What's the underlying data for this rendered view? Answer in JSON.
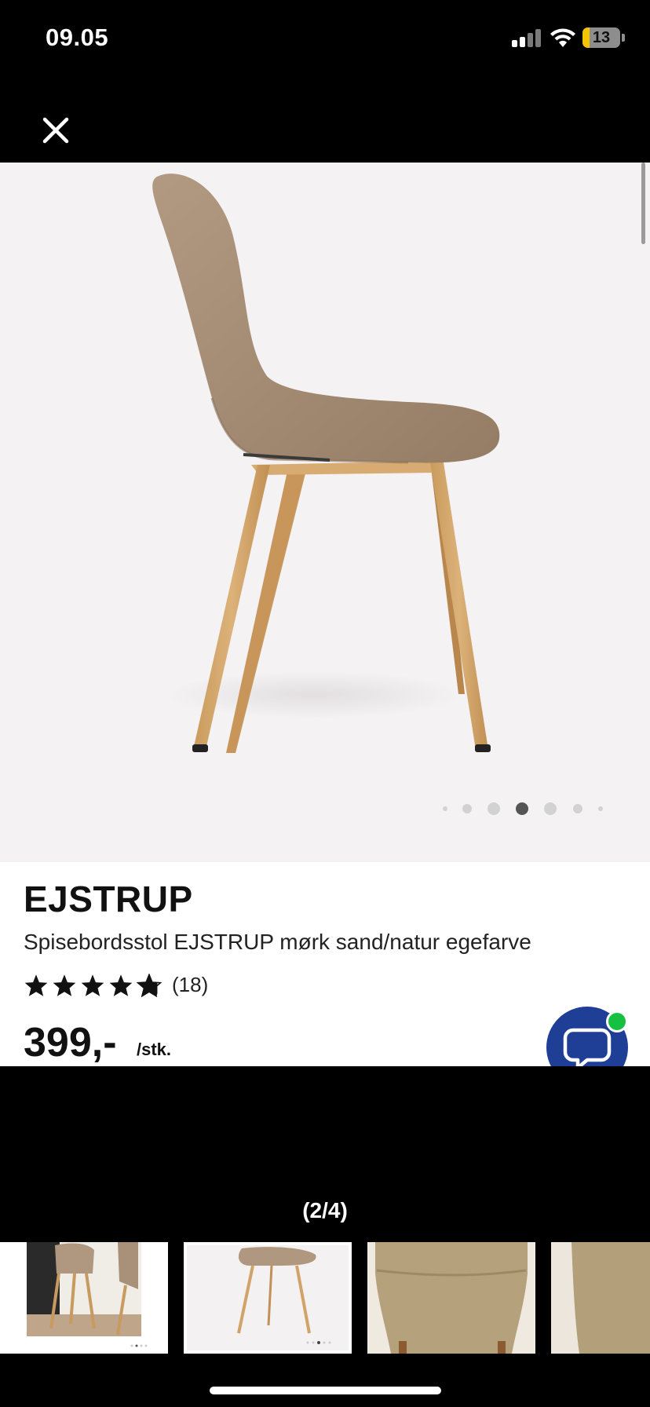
{
  "status_bar": {
    "time": "09.05",
    "battery": "13",
    "battery_color": "#f5c400",
    "icons": [
      "signal-icon",
      "wifi-icon",
      "battery-icon"
    ]
  },
  "header": {
    "close_icon": "close-icon"
  },
  "image_carousel": {
    "dot_count": 7,
    "active_dot": 4,
    "image_label": "chair-side-view"
  },
  "product": {
    "brand": "EJSTRUP",
    "description": "Spisebordsstol EJSTRUP mørk sand/natur egefarve",
    "rating": 4.8,
    "rating_max": 5,
    "review_count": "(18)",
    "price": "399,-",
    "unit": "/stk."
  },
  "chat": {
    "icon": "chat-bubble-icon",
    "accent_color": "#1f3f96",
    "online_color": "#16c142"
  },
  "gallery": {
    "counter": "(2/4)",
    "thumbnails": [
      "chair-in-room",
      "chair-side-view",
      "seat-close-up",
      "seat-close-up-2"
    ],
    "active_thumbnail": 2
  }
}
